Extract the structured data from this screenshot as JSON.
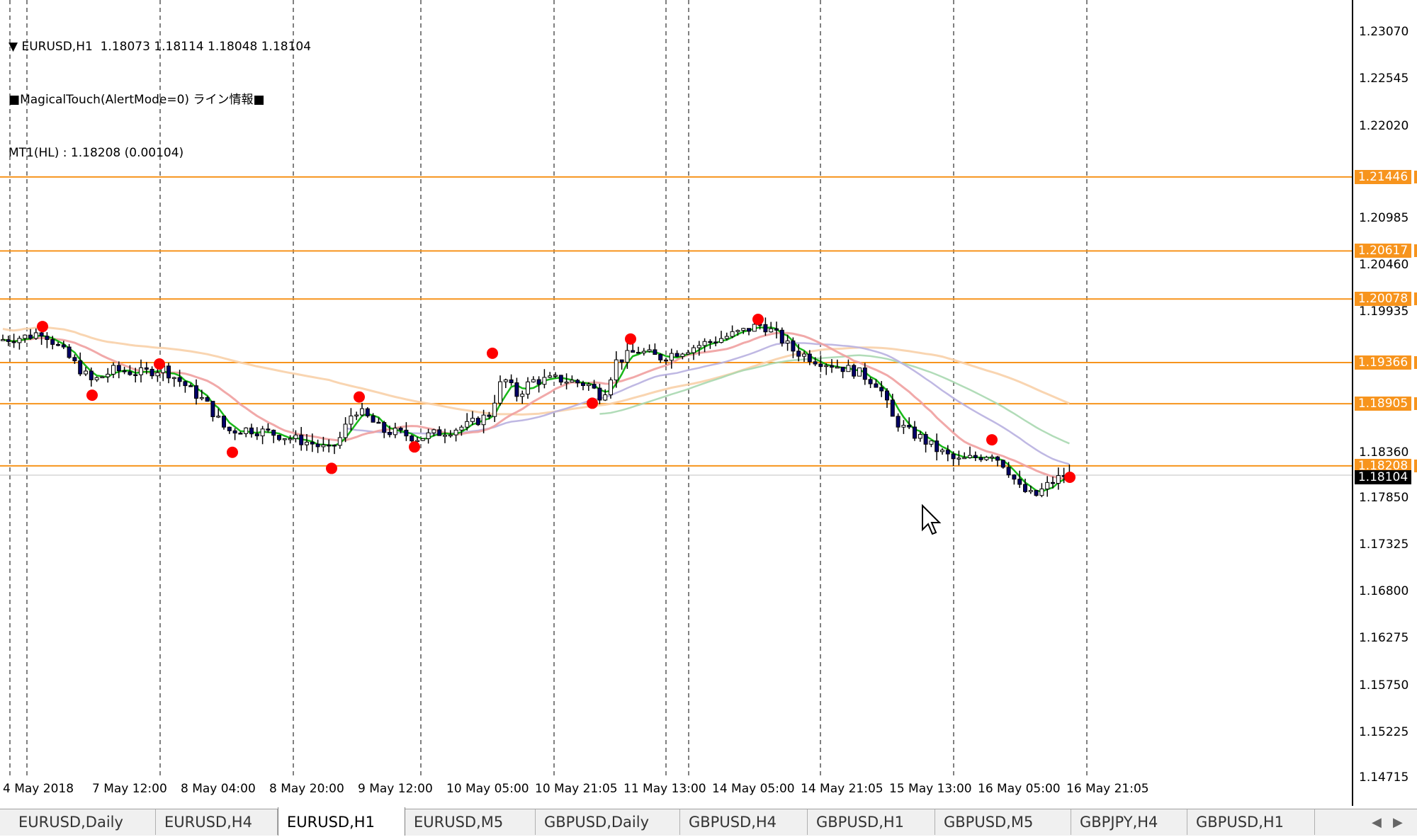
{
  "header": {
    "symbol_line": "EURUSD,H1  1.18073 1.18114 1.18048 1.18104",
    "indicator_line": "MagicalTouch(AlertMode=0) ライン情報",
    "mt_line": "MT1(HL) : 1.18208 (0.00104)"
  },
  "price_axis": {
    "labels": [
      "1.23070",
      "1.22545",
      "1.22020",
      "1.20985",
      "1.20460",
      "1.19935",
      "1.18360",
      "1.17850",
      "1.17325",
      "1.16800",
      "1.16275",
      "1.15750",
      "1.15225",
      "1.14715"
    ],
    "level_tags": [
      "1.21446",
      "1.20617",
      "1.20078",
      "1.19366",
      "1.18905",
      "1.18208"
    ],
    "current_price": "1.18104"
  },
  "time_axis": {
    "labels": [
      "4 May 2018",
      "7 May 12:00",
      "8 May 04:00",
      "8 May 20:00",
      "9 May 12:00",
      "10 May 05:00",
      "10 May 21:05",
      "11 May 13:00",
      "14 May 05:00",
      "14 May 21:05",
      "15 May 13:00",
      "16 May 05:00",
      "16 May 21:05"
    ]
  },
  "tabs": [
    {
      "label": "EURUSD,Daily",
      "active": false
    },
    {
      "label": "EURUSD,H4",
      "active": false
    },
    {
      "label": "EURUSD,H1",
      "active": true
    },
    {
      "label": "EURUSD,M5",
      "active": false
    },
    {
      "label": "GBPUSD,Daily",
      "active": false
    },
    {
      "label": "GBPUSD,H4",
      "active": false
    },
    {
      "label": "GBPUSD,H1",
      "active": false
    },
    {
      "label": "GBPUSD,M5",
      "active": false
    },
    {
      "label": "GBPJPY,H4",
      "active": false
    },
    {
      "label": "GBPUSD,H1",
      "active": false
    }
  ],
  "tab_scroll": {
    "left": "◀",
    "right": "▶"
  },
  "colors": {
    "level_line": "#f7941d",
    "bull_candle": "#ffffff",
    "bear_candle": "#000066",
    "ma_fast": "#00b000",
    "ma_red": "#f0a0a0",
    "ma_orange": "#f8d0a8",
    "ma_purple": "#b8b0e0",
    "ma_lightgreen": "#a8d8b0",
    "pivot_dot": "#ff0000"
  },
  "chart_data": {
    "type": "candlestick",
    "symbol": "EURUSD",
    "timeframe": "H1",
    "ylim": [
      1.14715,
      1.2335
    ],
    "yticks": [
      1.2307,
      1.22545,
      1.2202,
      1.20985,
      1.2046,
      1.19935,
      1.1836,
      1.1785,
      1.17325,
      1.168,
      1.16275,
      1.1575,
      1.15225,
      1.14715
    ],
    "levels": [
      1.21446,
      1.20617,
      1.20078,
      1.19366,
      1.18905,
      1.18208
    ],
    "current_price": 1.18104,
    "last_ohlc": {
      "open": 1.18073,
      "high": 1.18114,
      "low": 1.18048,
      "close": 1.18104
    },
    "price_path": [
      [
        0,
        1.1962
      ],
      [
        40,
        1.1966
      ],
      [
        60,
        1.1972
      ],
      [
        90,
        1.1948
      ],
      [
        130,
        1.1915
      ],
      [
        160,
        1.1928
      ],
      [
        200,
        1.1925
      ],
      [
        230,
        1.193
      ],
      [
        260,
        1.1912
      ],
      [
        290,
        1.1892
      ],
      [
        320,
        1.186
      ],
      [
        350,
        1.1862
      ],
      [
        380,
        1.1858
      ],
      [
        410,
        1.1852
      ],
      [
        440,
        1.1846
      ],
      [
        465,
        1.1838
      ],
      [
        480,
        1.1852
      ],
      [
        500,
        1.1885
      ],
      [
        520,
        1.1874
      ],
      [
        540,
        1.186
      ],
      [
        560,
        1.1858
      ],
      [
        590,
        1.1852
      ],
      [
        620,
        1.1858
      ],
      [
        660,
        1.1866
      ],
      [
        690,
        1.1878
      ],
      [
        710,
        1.192
      ],
      [
        730,
        1.19
      ],
      [
        750,
        1.1916
      ],
      [
        790,
        1.1918
      ],
      [
        830,
        1.1912
      ],
      [
        850,
        1.1898
      ],
      [
        870,
        1.1938
      ],
      [
        900,
        1.195
      ],
      [
        930,
        1.1942
      ],
      [
        970,
        1.1952
      ],
      [
        1010,
        1.1962
      ],
      [
        1050,
        1.1972
      ],
      [
        1075,
        1.198
      ],
      [
        1095,
        1.1968
      ],
      [
        1120,
        1.195
      ],
      [
        1150,
        1.194
      ],
      [
        1185,
        1.1932
      ],
      [
        1210,
        1.1926
      ],
      [
        1240,
        1.1912
      ],
      [
        1260,
        1.1874
      ],
      [
        1280,
        1.186
      ],
      [
        1300,
        1.1852
      ],
      [
        1320,
        1.184
      ],
      [
        1350,
        1.1826
      ],
      [
        1375,
        1.183
      ],
      [
        1400,
        1.1835
      ],
      [
        1420,
        1.182
      ],
      [
        1440,
        1.1795
      ],
      [
        1460,
        1.1786
      ],
      [
        1480,
        1.18
      ],
      [
        1500,
        1.181
      ],
      [
        1515,
        1.181
      ]
    ],
    "pivot_highs": [
      [
        60,
        1.1977
      ],
      [
        225,
        1.1935
      ],
      [
        507,
        1.1898
      ],
      [
        695,
        1.1947
      ],
      [
        890,
        1.1963
      ],
      [
        1070,
        1.1985
      ],
      [
        1400,
        1.185
      ]
    ],
    "pivot_lows": [
      [
        130,
        1.19
      ],
      [
        328,
        1.1836
      ],
      [
        468,
        1.1818
      ],
      [
        585,
        1.1842
      ],
      [
        836,
        1.1891
      ],
      [
        1510,
        1.1808
      ]
    ],
    "vertical_dashed_x": [
      14,
      38,
      226,
      414,
      594,
      782,
      940,
      972,
      1158,
      1346,
      1534
    ]
  }
}
